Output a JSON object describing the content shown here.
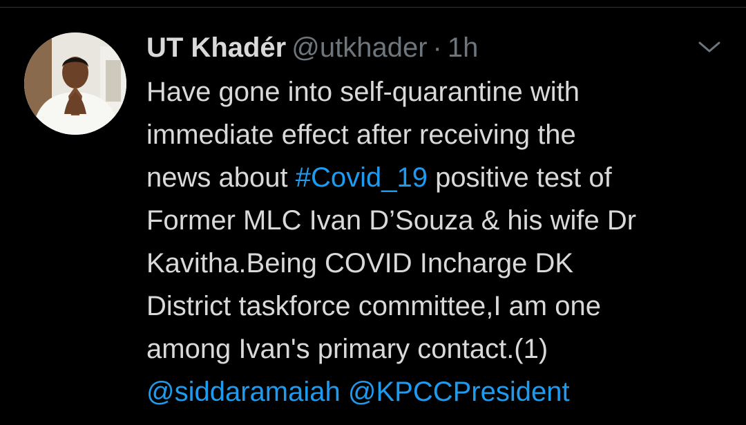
{
  "tweet": {
    "author": {
      "display_name": "UT Khadér",
      "handle": "@utkhader",
      "avatar_icon": "profile-photo-icon"
    },
    "separator": "·",
    "timestamp": "1h",
    "menu_icon": "chevron-down-icon",
    "text_lines": [
      {
        "parts": [
          {
            "text": "Have gone into self-quarantine with"
          }
        ]
      },
      {
        "parts": [
          {
            "text": "immediate effect after receiving the"
          }
        ]
      },
      {
        "parts": [
          {
            "text": "news about "
          },
          {
            "text": "#Covid_19",
            "link": true
          },
          {
            "text": " positive test of"
          }
        ]
      },
      {
        "parts": [
          {
            "text": "Former MLC Ivan D’Souza & his wife Dr"
          }
        ]
      },
      {
        "parts": [
          {
            "text": "Kavitha.Being COVID Incharge DK"
          }
        ]
      },
      {
        "parts": [
          {
            "text": "District taskforce committee,I am one"
          }
        ]
      },
      {
        "parts": [
          {
            "text": "among Ivan's primary contact.(1)"
          }
        ]
      },
      {
        "parts": [
          {
            "text": "@siddaramaiah",
            "link": true
          },
          {
            "text": " "
          },
          {
            "text": "@KPCCPresident",
            "link": true
          }
        ]
      }
    ]
  },
  "colors": {
    "background": "#000000",
    "primary_text": "#d9d9d9",
    "secondary_text": "#6e767d",
    "link": "#1d9bf0"
  }
}
